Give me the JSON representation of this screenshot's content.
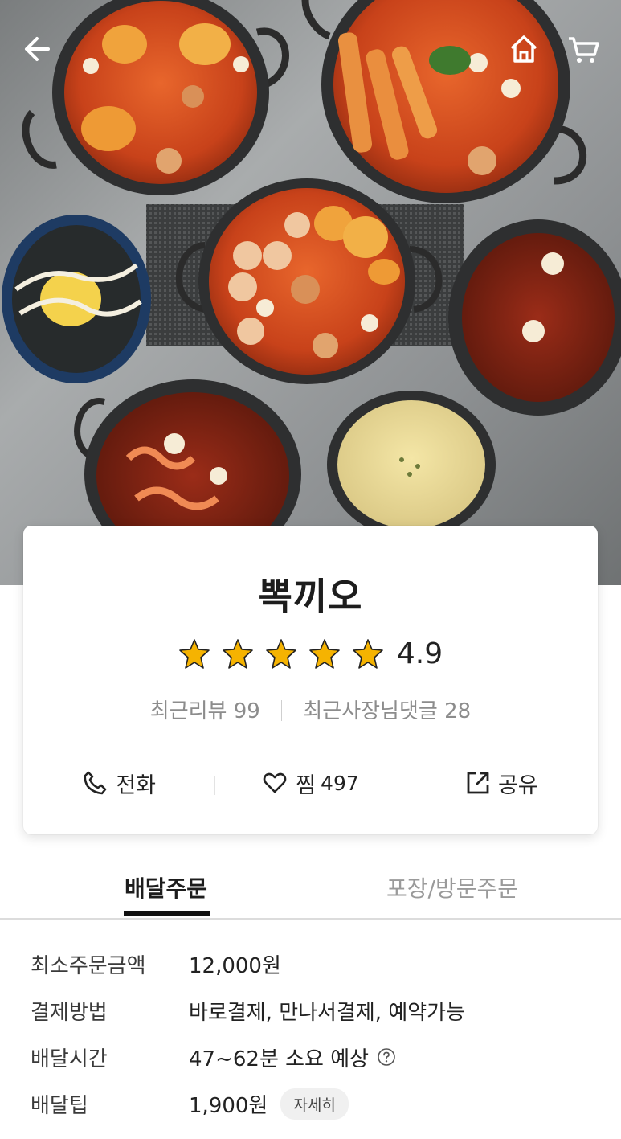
{
  "nav": {
    "back_icon": "back-arrow-icon",
    "home_icon": "home-icon",
    "cart_icon": "cart-icon"
  },
  "store": {
    "name": "뽁끼오",
    "rating": "4.9",
    "stars_filled": 5,
    "star_color": "#f5b301",
    "recent_reviews_label": "최근리뷰",
    "recent_reviews_count": "99",
    "owner_replies_label": "최근사장님댓글",
    "owner_replies_count": "28"
  },
  "actions": {
    "call_label": "전화",
    "like_label": "찜",
    "like_count": "497",
    "share_label": "공유"
  },
  "tabs": {
    "delivery": "배달주문",
    "pickup": "포장/방문주문"
  },
  "info": {
    "min_order_label": "최소주문금액",
    "min_order_value": "12,000원",
    "payment_label": "결제방법",
    "payment_value": "바로결제, 만나서결제, 예약가능",
    "delivery_time_label": "배달시간",
    "delivery_time_value": "47~62분 소요 예상",
    "delivery_tip_label": "배달팁",
    "delivery_tip_value": "1,900원",
    "detail_button": "자세히"
  }
}
